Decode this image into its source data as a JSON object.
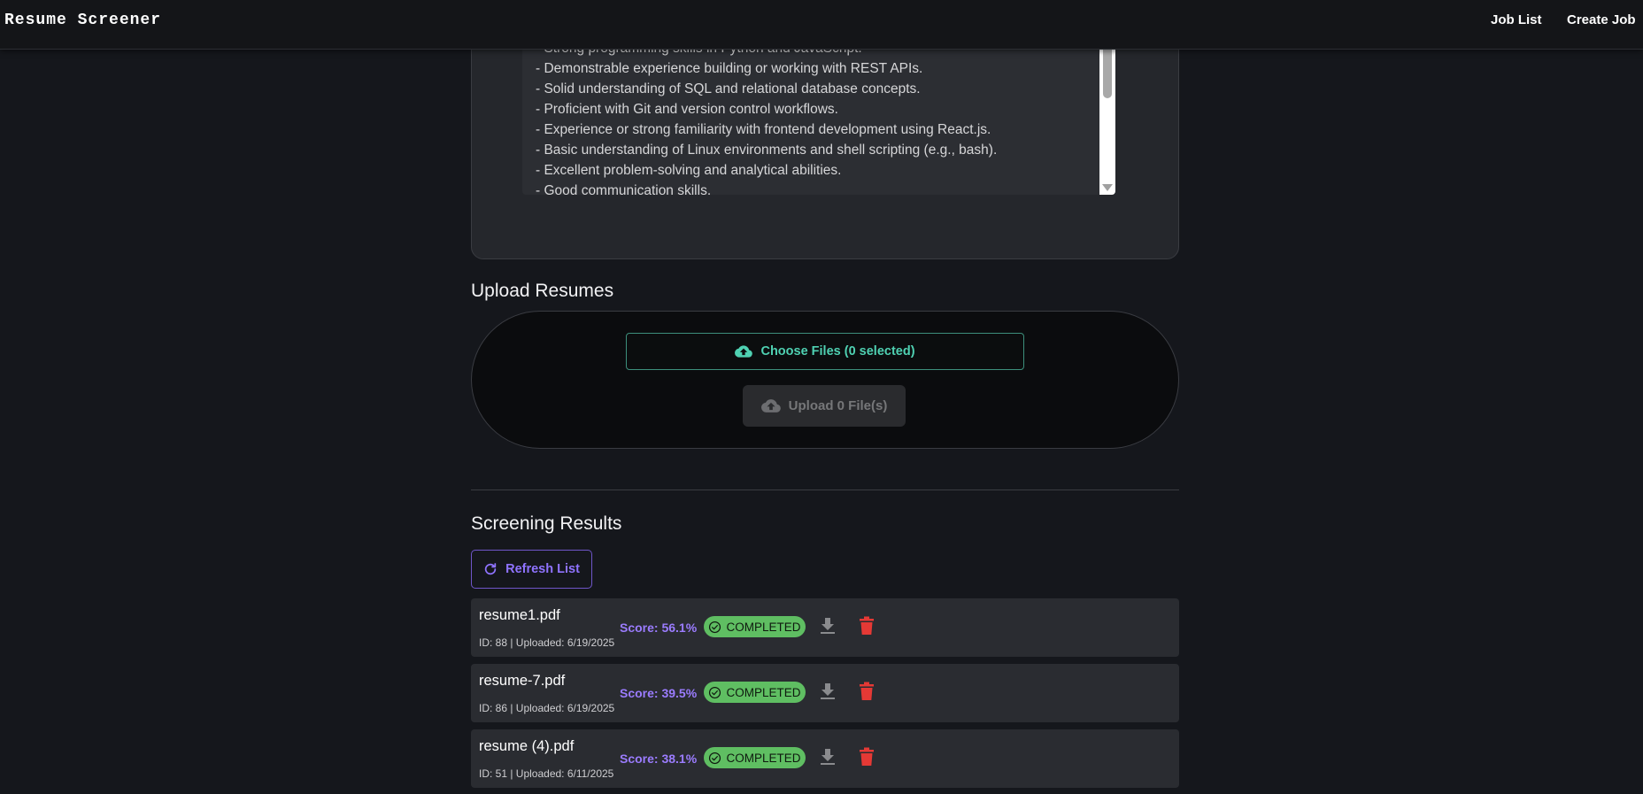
{
  "header": {
    "app_title": "Resume Screener",
    "nav": [
      {
        "label": "Job List"
      },
      {
        "label": "Create Job"
      }
    ]
  },
  "job_description": {
    "lines": [
      "- Strong programming skills in Python and JavaScript.",
      "- Demonstrable experience building or working with REST APIs.",
      "- Solid understanding of SQL and relational database concepts.",
      "- Proficient with Git and version control workflows.",
      "- Experience or strong familiarity with frontend development using React.js.",
      "- Basic understanding of Linux environments and shell scripting (e.g., bash).",
      "- Excellent problem-solving and analytical abilities.",
      "- Good communication skills."
    ]
  },
  "upload": {
    "title": "Upload Resumes",
    "choose_label": "Choose Files (0 selected)",
    "upload_label": "Upload 0 File(s)"
  },
  "results": {
    "title": "Screening Results",
    "refresh_label": "Refresh List",
    "rows": [
      {
        "file": "resume1.pdf",
        "meta": "ID: 88 | Uploaded: 6/19/2025",
        "score": "Score: 56.1%",
        "status": "COMPLETED"
      },
      {
        "file": "resume-7.pdf",
        "meta": "ID: 86 | Uploaded: 6/19/2025",
        "score": "Score: 39.5%",
        "status": "COMPLETED"
      },
      {
        "file": "resume (4).pdf",
        "meta": "ID: 51 | Uploaded: 6/11/2025",
        "score": "Score: 38.1%",
        "status": "COMPLETED"
      }
    ]
  },
  "colors": {
    "accent_purple": "#8f73ff",
    "accent_teal": "#4fd1b2",
    "status_green": "#5fbe62",
    "delete_red": "#e53935"
  },
  "icons": {
    "choose": "cloud-upload-icon",
    "upload": "cloud-upload-icon",
    "refresh": "refresh-icon",
    "status": "check-circle-icon",
    "download": "download-icon",
    "delete": "trash-icon"
  }
}
